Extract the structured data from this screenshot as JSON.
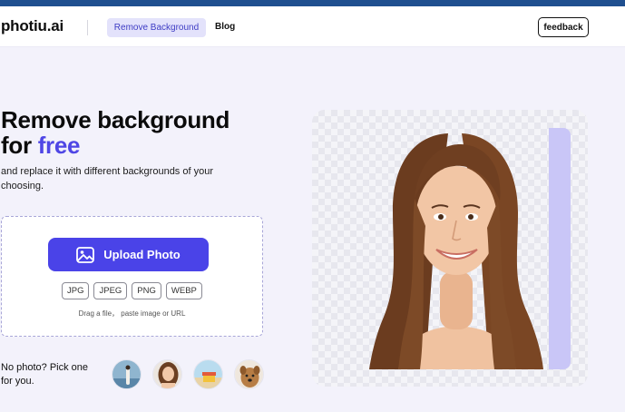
{
  "header": {
    "logo": "photiu.ai",
    "nav": [
      {
        "label": "Remove Background",
        "active": true
      },
      {
        "label": "Blog",
        "active": false
      }
    ],
    "feedback_label": "feedback"
  },
  "hero": {
    "title_line1": "Remove background",
    "title_line2_prefix": "for ",
    "title_line2_accent": "free",
    "subtitle": "and replace it with different backgrounds of your choosing."
  },
  "upload": {
    "button_label": "Upload Photo",
    "button_icon": "image-icon",
    "formats": [
      "JPG",
      "JPEG",
      "PNG",
      "WEBP"
    ],
    "hint": "Drag a file， paste image or URL"
  },
  "samples": {
    "label": "No photo? Pick one for you.",
    "items": [
      "sample-person-beach",
      "sample-woman-portrait",
      "sample-beach-chair",
      "sample-dog"
    ]
  },
  "colors": {
    "accent": "#4f46e5",
    "button": "#4a43e8",
    "page_bg": "#f3f2fb",
    "top_bar": "#1f4f8f"
  }
}
